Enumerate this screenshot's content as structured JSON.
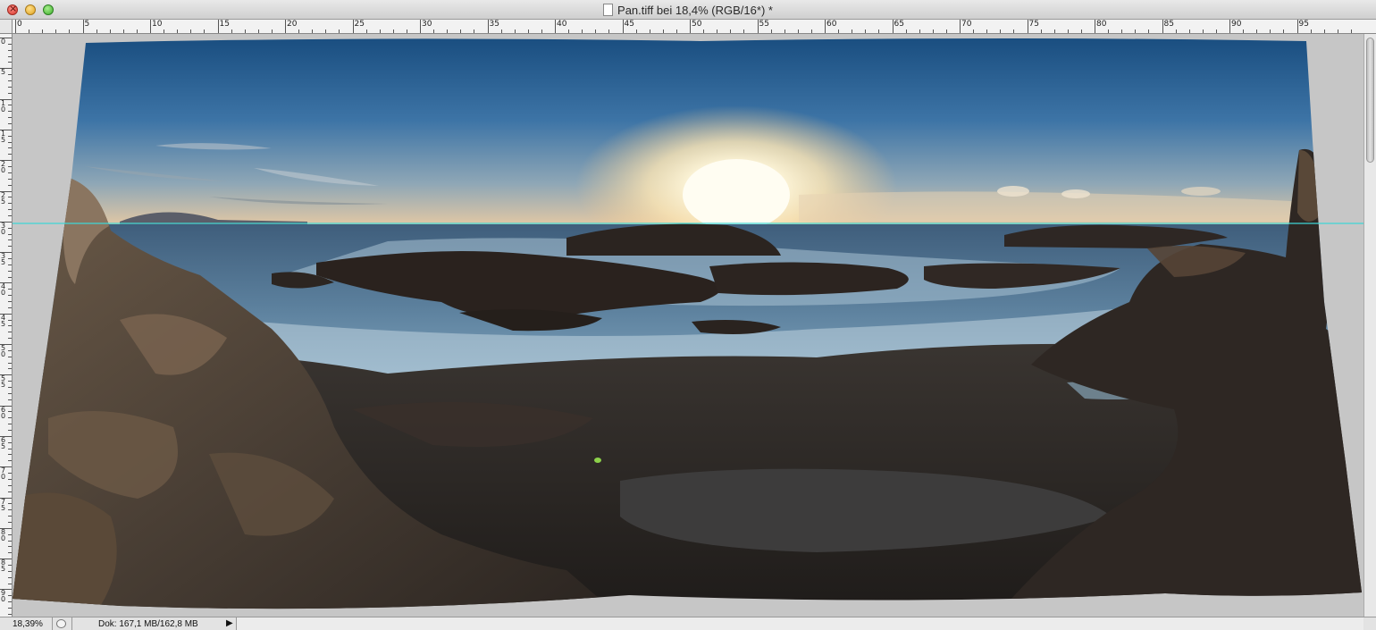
{
  "window": {
    "title": "Pan.tiff bei 18,4% (RGB/16*) *"
  },
  "ruler": {
    "horizontal_labels": [
      "0",
      "5",
      "10",
      "15",
      "20",
      "25",
      "30",
      "35",
      "40",
      "45",
      "50",
      "55",
      "60",
      "65",
      "70",
      "75",
      "80",
      "85",
      "90",
      "95"
    ],
    "vertical_labels": [
      "0",
      "5",
      "10",
      "15",
      "20",
      "25",
      "30",
      "35",
      "40",
      "45",
      "50",
      "55",
      "60",
      "65",
      "70",
      "75",
      "80",
      "85",
      "90",
      "95"
    ]
  },
  "canvas": {
    "image": "sunset-coast-panorama",
    "guide_color": "#3fd6d6"
  },
  "status": {
    "zoom": "18,39%",
    "doc_info": "Dok: 167,1 MB/162,8 MB"
  },
  "colors": {
    "titlebar": "#dcdcdc",
    "pasteboard": "#c6c6c6"
  }
}
